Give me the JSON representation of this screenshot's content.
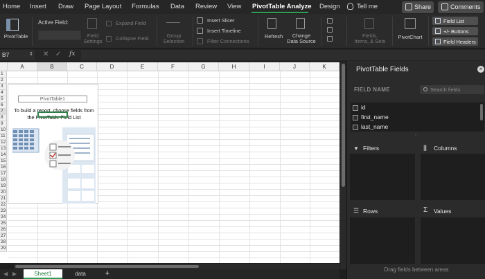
{
  "menu": {
    "tabs": [
      "Home",
      "Insert",
      "Draw",
      "Page Layout",
      "Formulas",
      "Data",
      "Review",
      "View",
      "PivotTable Analyze",
      "Design",
      "Tell me"
    ],
    "share_label": "Share",
    "comments_label": "Comments",
    "accent_color": "#2f9e55"
  },
  "ribbon": {
    "pivottable_label": "PivotTable",
    "active_field_label": "Active Field:",
    "field_settings_label": "Field\nSettings",
    "expand_field_label": "Expand Field",
    "collapse_field_label": "Collapse Field",
    "group_selection_label": "Group\nSelection",
    "insert_slicer_label": "Insert Slicer",
    "insert_timeline_label": "Insert Timeline",
    "filter_connections_label": "Filter Connections",
    "refresh_label": "Refresh",
    "change_data_source_label": "Change\nData Source",
    "fields_items_sets_label": "Fields,\nItems, & Sets",
    "pivotchart_label": "PivotChart",
    "field_list_label": "Field List",
    "buttons_label": "+/- Buttons",
    "field_headers_label": "Field Headers"
  },
  "formula_bar": {
    "name_box": "B7",
    "fx_label": "fx",
    "formula": ""
  },
  "grid": {
    "columns": [
      "A",
      "B",
      "C",
      "D",
      "E",
      "F",
      "G",
      "H",
      "I",
      "J",
      "K"
    ],
    "selected_column": "B",
    "rows": [
      "1",
      "2",
      "3",
      "4",
      "5",
      "6",
      "7",
      "8",
      "9",
      "10",
      "11",
      "12",
      "13",
      "14",
      "15",
      "16",
      "17",
      "18",
      "19",
      "20",
      "21",
      "22",
      "23",
      "24",
      "25",
      "26",
      "27",
      "28",
      "29"
    ],
    "pivot_title": "PivotTable1",
    "pivot_text_line1": "To build a report, choose fields from",
    "pivot_text_line2": "the PivotTable Field List"
  },
  "sheet_tabs": {
    "tabs": [
      "Sheet1",
      "data"
    ],
    "active": "Sheet1",
    "add_label": "+"
  },
  "pane": {
    "title": "PivotTable Fields",
    "field_name_label": "FIELD NAME",
    "search_placeholder": "Search fields",
    "fields": [
      "id",
      "first_name",
      "last_name"
    ],
    "filters_label": "Filters",
    "columns_label": "Columns",
    "rows_label": "Rows",
    "values_label": "Values",
    "footer": "Drag fields between areas"
  }
}
